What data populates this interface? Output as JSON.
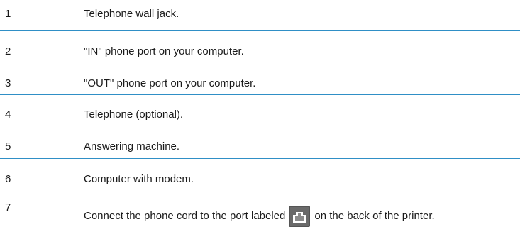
{
  "legend": {
    "rows": [
      {
        "number": "1",
        "text": "Telephone wall jack."
      },
      {
        "number": "2",
        "text": "\"IN\" phone port on your computer."
      },
      {
        "number": "3",
        "text": "\"OUT\" phone port on your computer."
      },
      {
        "number": "4",
        "text": "Telephone (optional)."
      },
      {
        "number": "5",
        "text": "Answering machine."
      },
      {
        "number": "6",
        "text": "Computer with modem."
      },
      {
        "number": "7",
        "text_before": "Connect the phone cord to the port labeled",
        "icon": "phone-port-icon",
        "text_after": "on the back of the printer."
      }
    ]
  },
  "colors": {
    "divider": "#2f8fc6",
    "text": "#1a1a1a"
  }
}
